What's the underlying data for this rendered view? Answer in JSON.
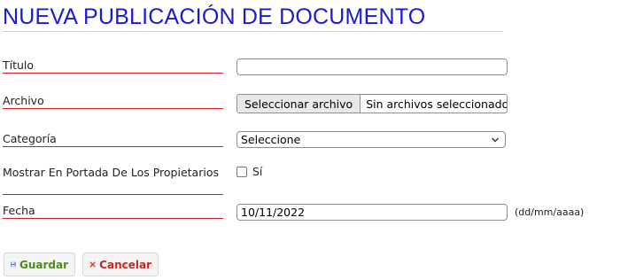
{
  "header": {
    "title": "NUEVA PUBLICACIÓN DE DOCUMENTO"
  },
  "form": {
    "titulo": {
      "label": "Título",
      "value": ""
    },
    "archivo": {
      "label": "Archivo",
      "button_label": "Seleccionar archivo",
      "status": "Sin archivos seleccionados"
    },
    "categoria": {
      "label": "Categoría",
      "selected": "Seleccione"
    },
    "portada": {
      "label": "Mostrar En Portada De Los Propietarios",
      "option_label": "Sí",
      "checked": false
    },
    "fecha": {
      "label": "Fecha",
      "value": "10/11/2022",
      "hint": "(dd/mm/aaaa)"
    }
  },
  "actions": {
    "save_label": "Guardar",
    "cancel_label": "Cancelar",
    "save_color": "#4a8a1a",
    "cancel_color": "#c8261e",
    "save_icon": "floppy-disk-icon",
    "cancel_icon": "red-x-icon"
  },
  "colors": {
    "title": "#1a1ad4",
    "label_underline": "#d21f1f"
  }
}
